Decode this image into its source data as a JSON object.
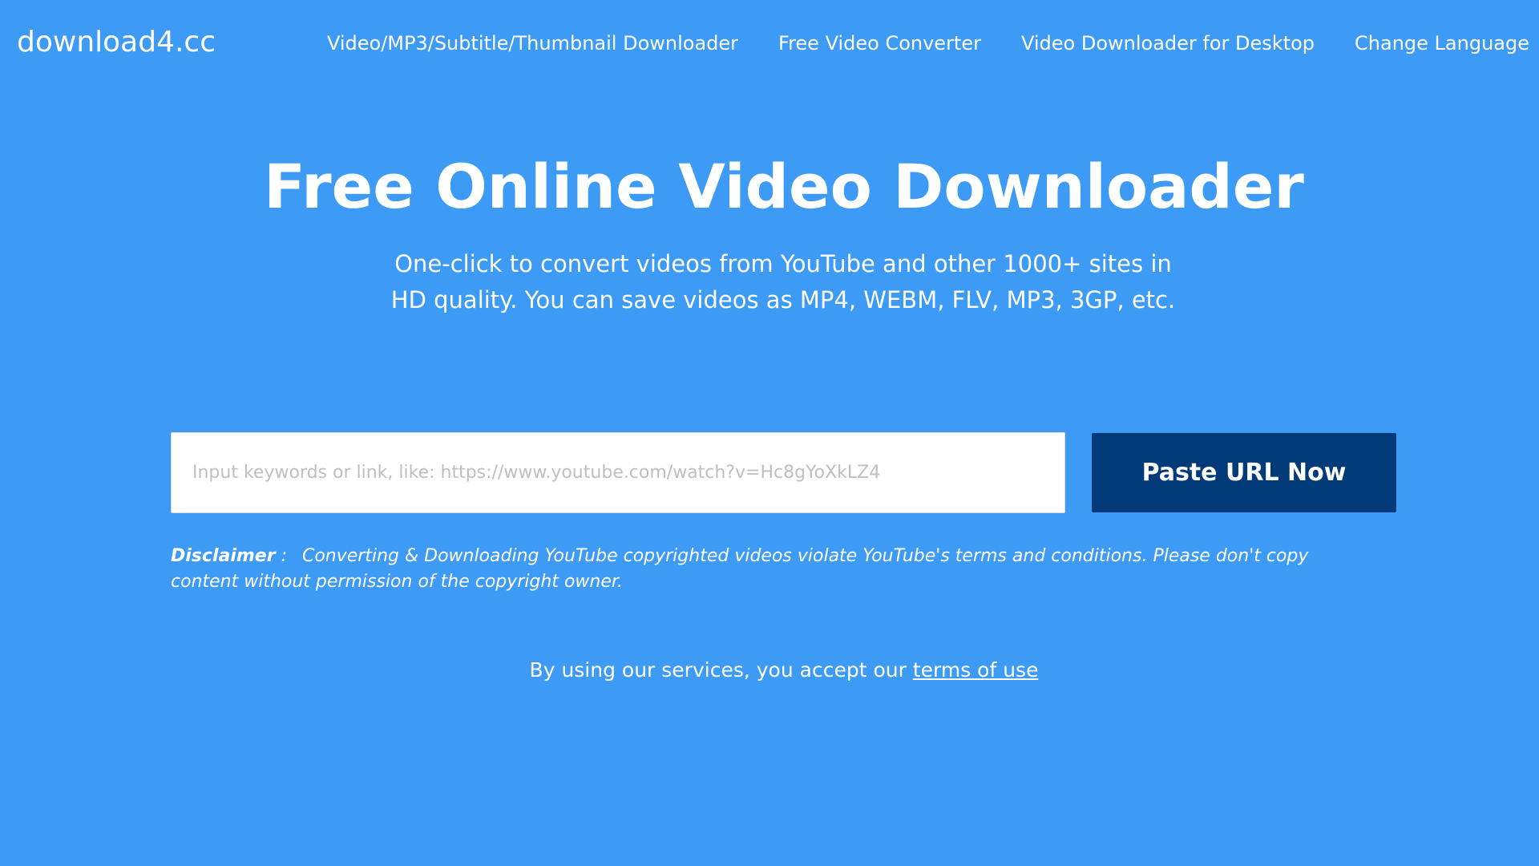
{
  "colors": {
    "background": "#3d9bf5",
    "button": "#003a78",
    "text": "#ffffff",
    "input_background": "#ffffff",
    "placeholder": "#bfbfbf"
  },
  "header": {
    "logo": "download4.cc",
    "nav": [
      {
        "label": "Video/MP3/Subtitle/Thumbnail Downloader"
      },
      {
        "label": "Free Video Converter"
      },
      {
        "label": "Video Downloader for Desktop"
      },
      {
        "label": "Change Language"
      }
    ]
  },
  "hero": {
    "title": "Free Online Video Downloader",
    "subtitle": "One-click to convert videos from YouTube and other 1000+ sites in HD quality. You can save videos as MP4, WEBM, FLV, MP3, 3GP, etc."
  },
  "search": {
    "placeholder": "Input keywords or link, like: https://www.youtube.com/watch?v=Hc8gYoXkLZ4",
    "value": "",
    "button_label": "Paste URL Now"
  },
  "disclaimer": {
    "label": "Disclaimer",
    "separator": ":",
    "text": "Converting & Downloading YouTube copyrighted videos violate YouTube's terms and conditions. Please don't copy content without permission of the copyright owner."
  },
  "terms": {
    "prefix": "By using our services, you accept our ",
    "link_label": "terms of use"
  }
}
